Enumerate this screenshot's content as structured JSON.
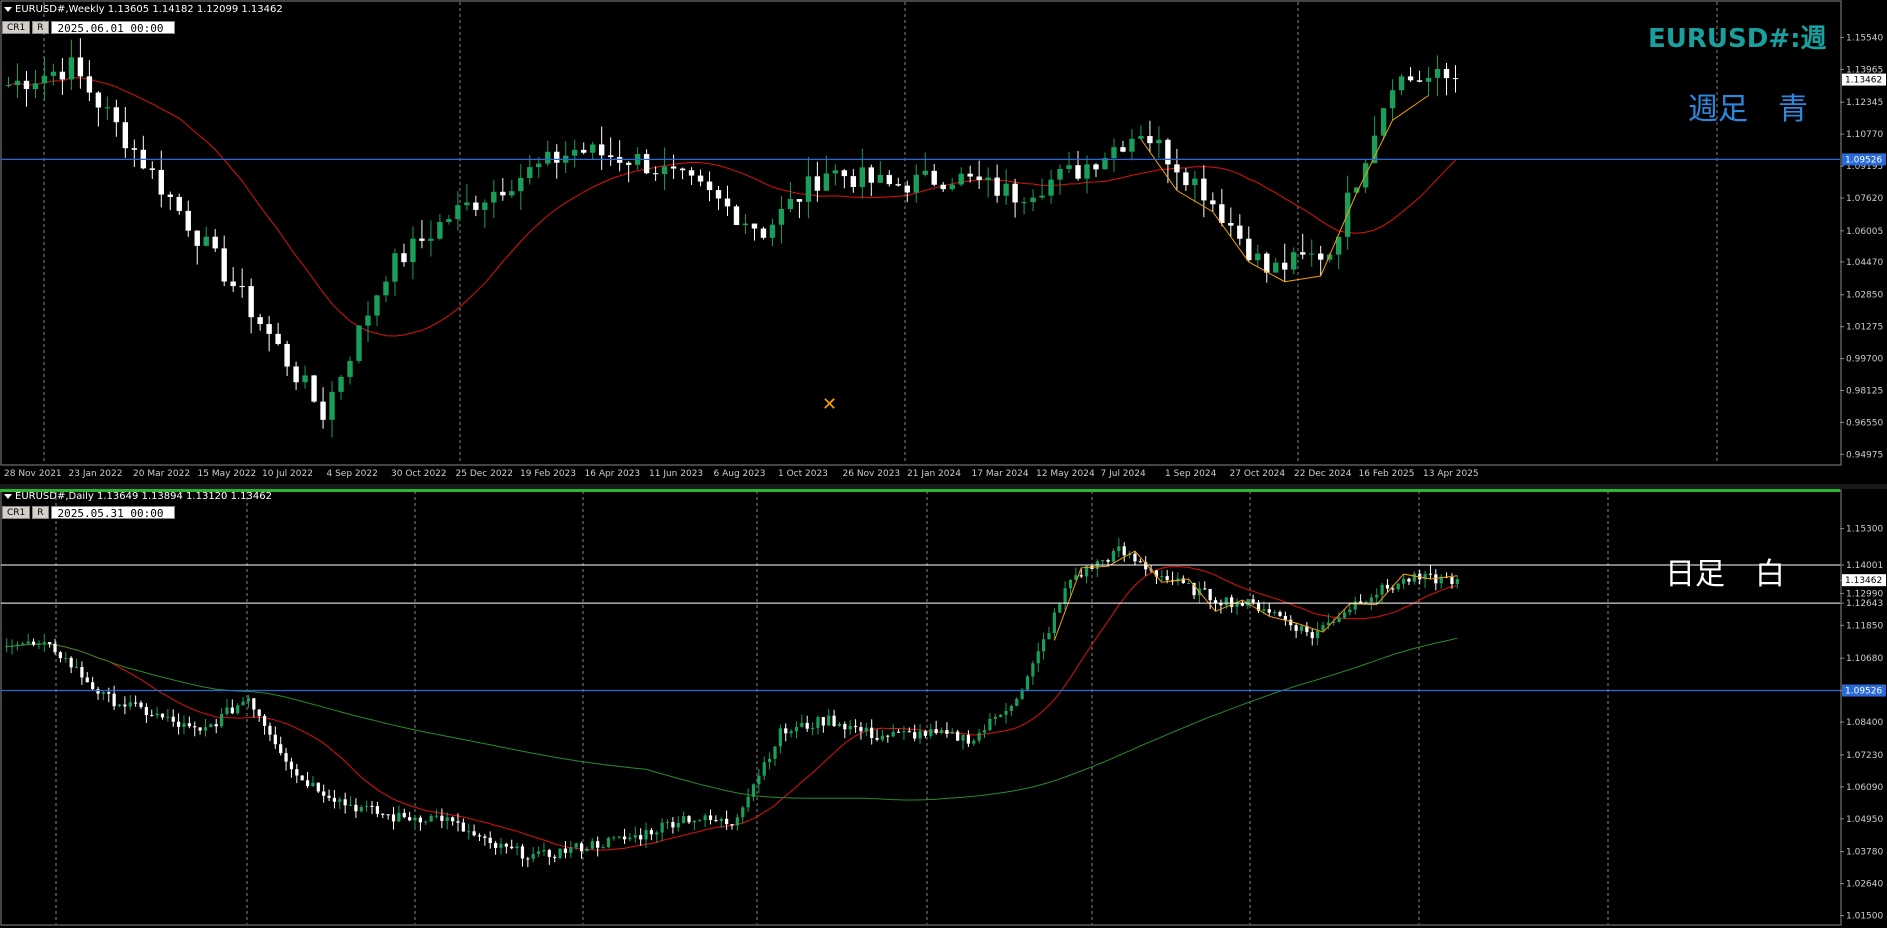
{
  "top": {
    "header": "EURUSD#,Weekly  1.13605 1.14182 1.12099 1.13462",
    "tool_cr": "CR1",
    "tool_r": "R",
    "date": "2025.06.01 00:00",
    "symbol_label": "EURUSD#:週",
    "timeframe_label": "週足　青",
    "price_labels": [
      "1.15540",
      "1.13965",
      "1.12345",
      "1.10770",
      "1.09195",
      "1.07620",
      "1.06005",
      "1.04470",
      "1.02850",
      "1.01275",
      "0.99700",
      "0.98125",
      "0.96550",
      "0.94975"
    ],
    "current_price": "1.13462",
    "hline_price": "1.09526",
    "date_labels": [
      "28 Nov 2021",
      "23 Jan 2022",
      "20 Mar 2022",
      "15 May 2022",
      "10 Jul 2022",
      "4 Sep 2022",
      "30 Oct 2022",
      "25 Dec 2022",
      "19 Feb 2023",
      "16 Apr 2023",
      "11 Jun 2023",
      "6 Aug 2023",
      "1 Oct 2023",
      "26 Nov 2023",
      "21 Jan 2024",
      "17 Mar 2024",
      "12 May 2024",
      "7 Jul 2024",
      "1 Sep 2024",
      "27 Oct 2024",
      "22 Dec 2024",
      "16 Feb 2025",
      "13 Apr 2025"
    ]
  },
  "bottom": {
    "header": "EURUSD#,Daily  1.13649 1.13894 1.13120 1.13462",
    "tool_cr": "CR1",
    "tool_r": "R",
    "date": "2025.05.31 00:00",
    "timeframe_label": "日足　白",
    "price_labels": [
      "1.15300",
      "1.14001",
      "1.13462",
      "1.12990",
      "1.12643",
      "1.11850",
      "1.10680",
      "1.09526",
      "1.08400",
      "1.07230",
      "1.06090",
      "1.04950",
      "1.03780",
      "1.02640",
      "1.01500"
    ],
    "current_price": "1.13462",
    "hline_price": "1.09526",
    "upper_line": "1.14001",
    "lower_line": "1.12643"
  },
  "colors": {
    "background": "#000000",
    "bull": "#1a9e5a",
    "bear": "#ffffff",
    "ma_red": "#e01010",
    "ma_green": "#2a8a2a",
    "zigzag": "#f0a000",
    "hline_blue": "#2a6ad8",
    "label_teal": "#1a9e9e",
    "label_blue": "#2a8ae0"
  },
  "chart_data": [
    {
      "type": "candlestick",
      "name": "EURUSD# Weekly",
      "x": [
        "28 Nov 2021",
        "23 Jan 2022",
        "20 Mar 2022",
        "15 May 2022",
        "10 Jul 2022",
        "4 Sep 2022",
        "30 Oct 2022",
        "25 Dec 2022",
        "19 Feb 2023",
        "16 Apr 2023",
        "11 Jun 2023",
        "6 Aug 2023",
        "1 Oct 2023",
        "26 Nov 2023",
        "21 Jan 2024",
        "17 Mar 2024",
        "12 May 2024",
        "7 Jul 2024",
        "1 Sep 2024",
        "27 Oct 2024",
        "22 Dec 2024",
        "16 Feb 2025",
        "13 Apr 2025",
        "1 Jun 2025"
      ],
      "close": [
        1.132,
        1.141,
        1.1,
        1.058,
        1.015,
        0.97,
        1.04,
        1.067,
        1.085,
        1.1,
        1.095,
        1.08,
        1.06,
        1.09,
        1.082,
        1.087,
        1.078,
        1.09,
        1.11,
        1.08,
        1.04,
        1.05,
        1.135,
        1.135
      ],
      "ylim": [
        0.945,
        1.165
      ],
      "hline": 1.09526
    },
    {
      "type": "candlestick",
      "name": "EURUSD# Daily",
      "close": [
        1.113,
        1.11,
        1.093,
        1.087,
        1.08,
        1.093,
        1.065,
        1.055,
        1.05,
        1.05,
        1.04,
        1.036,
        1.04,
        1.043,
        1.05,
        1.048,
        1.08,
        1.085,
        1.079,
        1.08,
        1.078,
        1.095,
        1.135,
        1.145,
        1.135,
        1.128,
        1.125,
        1.115,
        1.128,
        1.135,
        1.135
      ],
      "ylim": [
        1.012,
        1.16
      ],
      "hline": 1.09526,
      "hlines": [
        1.14001,
        1.12643
      ]
    }
  ]
}
